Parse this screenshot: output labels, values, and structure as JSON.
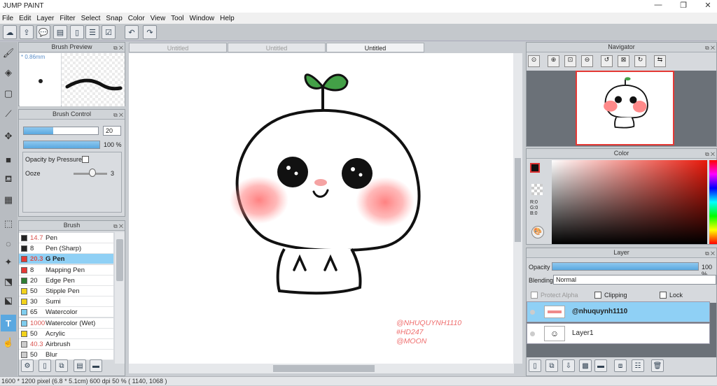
{
  "app": {
    "title": "JUMP PAINT"
  },
  "window_controls": {
    "minimize": "—",
    "maximize": "❐",
    "close": "✕"
  },
  "menu": [
    "File",
    "Edit",
    "Layer",
    "Filter",
    "Select",
    "Snap",
    "Color",
    "View",
    "Tool",
    "Window",
    "Help"
  ],
  "brush_preview": {
    "title": "Brush Preview",
    "size_label": "* 0.86mm"
  },
  "brush_control": {
    "title": "Brush Control",
    "size_value": "20",
    "size_fill": 0.4,
    "opacity_value": "100 %",
    "opacity_fill": 1.0,
    "opacity_by_pressure_label": "Opacity by Pressure",
    "ooze_label": "Ooze",
    "ooze_value": "3"
  },
  "brush_list": {
    "title": "Brush",
    "items": [
      {
        "color": "#222222",
        "size": "14.7",
        "size_color": "#d9534f",
        "name": "Pen"
      },
      {
        "color": "#222222",
        "size": "8",
        "size_color": "#222222",
        "name": "Pen (Sharp)"
      },
      {
        "color": "#e53935",
        "size": "20.3",
        "size_color": "#d9534f",
        "name": "G Pen",
        "selected": true
      },
      {
        "color": "#e53935",
        "size": "8",
        "size_color": "#222222",
        "name": "Mapping Pen"
      },
      {
        "color": "#2e7d32",
        "size": "20",
        "size_color": "#222222",
        "name": "Edge Pen"
      },
      {
        "color": "#f2d21b",
        "size": "50",
        "size_color": "#222222",
        "name": "Stipple Pen"
      },
      {
        "color": "#f2d21b",
        "size": "30",
        "size_color": "#222222",
        "name": "Sumi"
      },
      {
        "color": "#7fcdee",
        "size": "65",
        "size_color": "#222222",
        "name": "Watercolor"
      },
      {
        "color": "#7fcdee",
        "size": "1000",
        "size_color": "#d9534f",
        "name": "Watercolor (Wet)"
      },
      {
        "color": "#f2d21b",
        "size": "50",
        "size_color": "#222222",
        "name": "Acrylic"
      },
      {
        "color": "#cccccc",
        "size": "40.3",
        "size_color": "#d9534f",
        "name": "Airbrush"
      },
      {
        "color": "#cccccc",
        "size": "50",
        "size_color": "#222222",
        "name": "Blur"
      }
    ]
  },
  "tabs": [
    {
      "label": "Untitled",
      "active": false
    },
    {
      "label": "Untitled",
      "active": false
    },
    {
      "label": "Untitled",
      "active": true
    }
  ],
  "artwork": {
    "watermark_lines": [
      "@NHUQUYNH1110",
      "#HD247",
      "@MOON"
    ]
  },
  "navigator": {
    "title": "Navigator"
  },
  "color_panel": {
    "title": "Color",
    "r": "R:0",
    "g": "G:0",
    "b": "B:0"
  },
  "layer_panel": {
    "title": "Layer",
    "opacity_label": "Opacity",
    "opacity_value": "100 %",
    "opacity_fill": 1.0,
    "blending_label": "Blending",
    "blending_value": "Normal",
    "protect_alpha_label": "Protect Alpha",
    "clipping_label": "Clipping",
    "lock_label": "Lock",
    "layers": [
      {
        "name": "@nhuquynh1110",
        "selected": true
      },
      {
        "name": "Layer1",
        "selected": false
      }
    ]
  },
  "status": {
    "text": "1600 * 1200 pixel   (6.8 * 5.1cm)   600 dpi   50 %   ( 1140, 1068 )"
  }
}
